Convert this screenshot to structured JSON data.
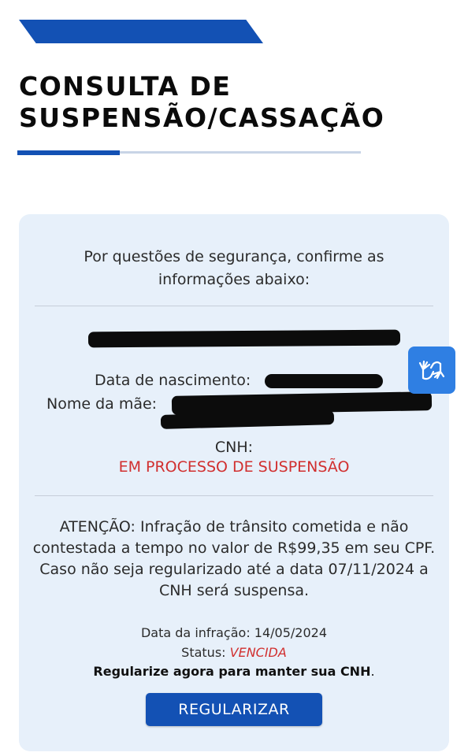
{
  "header": {
    "title_line1": "CONSULTA DE",
    "title_line2": "SUSPENSÃO/CASSAÇÃO"
  },
  "card": {
    "prompt": "Por questões de segurança, confirme as informações abaixo:",
    "birth_date_label": "Data de nascimento:",
    "mother_name_label": "Nome da mãe:",
    "cnh_label": "CNH:",
    "cnh_status": "EM PROCESSO DE SUSPENSÃO",
    "warning": "ATENÇÃO: Infração de trânsito cometida e não contestada a tempo no valor de R$99,35 em seu CPF. Caso não seja regularizado até a data 07/11/2024 a CNH será suspensa.",
    "infraction_date_label": "Data da infração:",
    "infraction_date": "14/05/2024",
    "status_label": "Status:",
    "status_value": "VENCIDA",
    "cta_bold": "Regularize agora para manter sua CNH",
    "cta_end": ".",
    "button_label": "REGULARIZAR"
  },
  "accessibility": {
    "icon": "libras-hands-icon"
  },
  "colors": {
    "primary": "#1351b4",
    "card_bg": "#e7f0fa",
    "alert": "#d12f2f",
    "accessibility_button": "#2f7fe3"
  }
}
